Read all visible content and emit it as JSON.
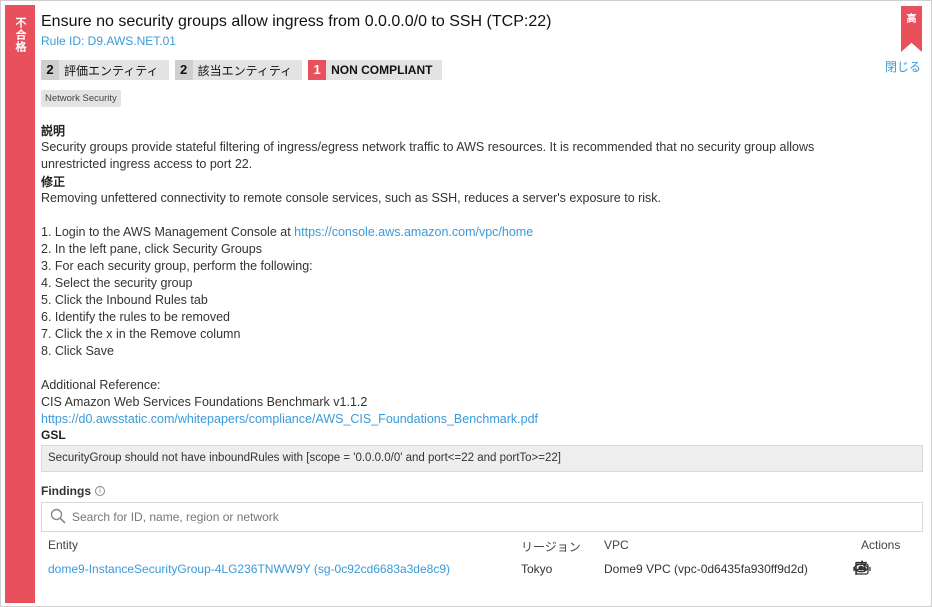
{
  "status_strip": {
    "label": "不合格"
  },
  "severity_badge": {
    "label": "高"
  },
  "close_link": "閉じる",
  "rule": {
    "title": "Ensure no security groups allow ingress from 0.0.0.0/0 to SSH (TCP:22)",
    "rule_id": "Rule ID: D9.AWS.NET.01"
  },
  "stats": [
    {
      "count": "2",
      "label": "評価エンティティ"
    },
    {
      "count": "2",
      "label": "該当エンティティ"
    },
    {
      "count": "1",
      "label": "NON COMPLIANT"
    }
  ],
  "tag": "Network Security",
  "description": {
    "heading": "説明",
    "line1": "Security groups provide stateful filtering of ingress/egress network traffic to AWS resources. It is recommended that no security group allows",
    "line2": "unrestricted ingress access to port 22."
  },
  "remediation": {
    "heading": "修正",
    "intro": "Removing unfettered connectivity to remote console services, such as SSH, reduces a server's exposure to risk.",
    "step1_prefix": "1. Login to the AWS Management Console at ",
    "step1_link": "https://console.aws.amazon.com/vpc/home",
    "steps": [
      "2. In the left pane, click Security Groups",
      "3. For each security group, perform the following:",
      "4. Select the security group",
      "5. Click the Inbound Rules tab",
      "6. Identify the rules to be removed",
      "7. Click the x in the Remove column",
      "8. Click Save"
    ],
    "ref_heading": "Additional Reference:",
    "ref_title": "CIS Amazon Web Services Foundations Benchmark v1.1.2",
    "ref_link": "https://d0.awsstatic.com/whitepapers/compliance/AWS_CIS_Foundations_Benchmark.pdf"
  },
  "gsl": {
    "heading": "GSL",
    "expression": "SecurityGroup should not have inboundRules with [scope =  '0.0.0.0/0' and port<=22 and portTo>=22]"
  },
  "findings": {
    "heading": "Findings",
    "search_placeholder": "Search for ID, name, region or network",
    "columns": {
      "entity": "Entity",
      "region": "リージョン",
      "vpc": "VPC",
      "actions": "Actions"
    },
    "rows": [
      {
        "entity": "dome9-InstanceSecurityGroup-4LG236TNWW9Y (sg-0c92cd6683a3de8c9)",
        "region": "Tokyo",
        "vpc": "Dome9 VPC (vpc-0d6435fa930ff9d2d)"
      }
    ]
  },
  "colors": {
    "danger": "#e8505b",
    "link": "#3a9ad9"
  },
  "icons": [
    "info-icon",
    "search-icon",
    "eye-icon",
    "flag-icon",
    "robot-icon"
  ]
}
